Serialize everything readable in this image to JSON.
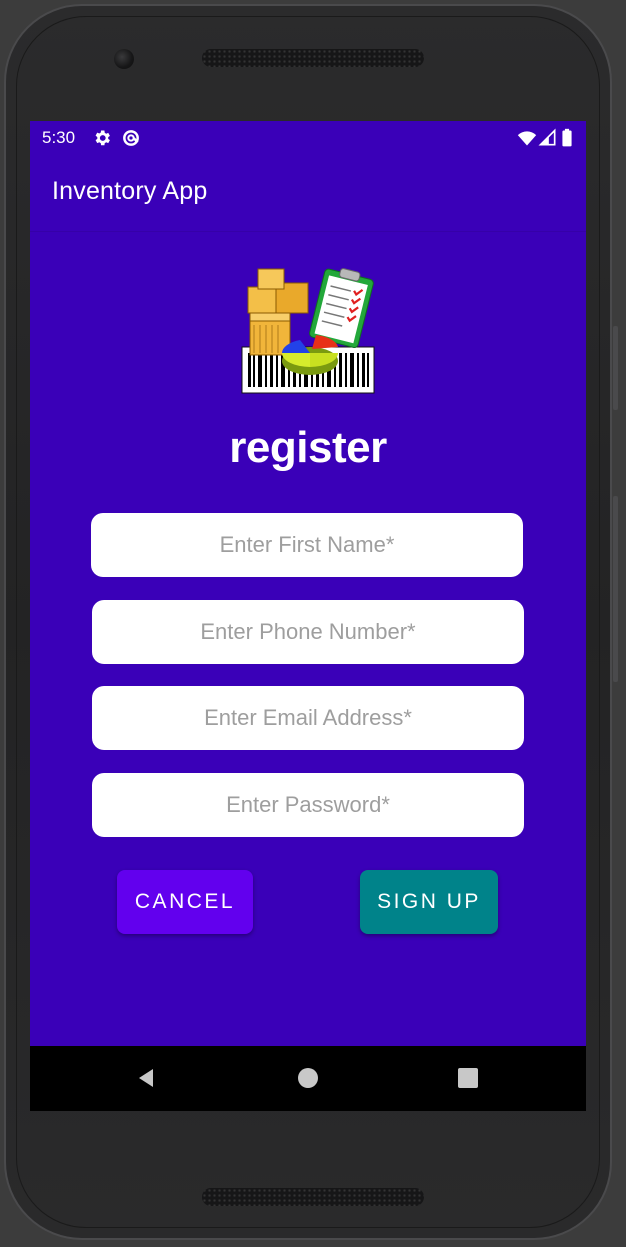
{
  "status_bar": {
    "time": "5:30",
    "icons_left": [
      "settings-icon",
      "sync-icon"
    ],
    "icons_right": [
      "wifi-icon",
      "signal-icon",
      "battery-icon"
    ]
  },
  "app_bar": {
    "title": "Inventory App"
  },
  "form": {
    "heading": "register",
    "fields": {
      "first_name": {
        "value": "",
        "placeholder": "Enter First Name*"
      },
      "phone": {
        "value": "",
        "placeholder": "Enter Phone Number*"
      },
      "email": {
        "value": "",
        "placeholder": "Enter Email Address*"
      },
      "password": {
        "value": "",
        "placeholder": "Enter Password*"
      }
    },
    "cancel_label": "CANCEL",
    "signup_label": "SIGN UP"
  },
  "nav_bar": {
    "buttons": [
      "back-icon",
      "home-icon",
      "recents-icon"
    ]
  },
  "colors": {
    "screen_background": "#3a00b8",
    "cancel_button": "#6200ee",
    "signup_button": "#00838a",
    "field_background": "#ffffff",
    "placeholder_text": "#9e9e9e"
  }
}
